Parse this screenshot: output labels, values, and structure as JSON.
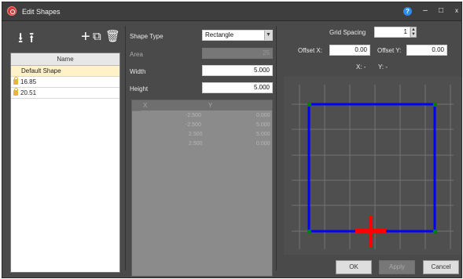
{
  "window": {
    "title": "Edit Shapes",
    "help_label": "?",
    "controls": [
      "–",
      "□",
      "x"
    ]
  },
  "toolbar": {
    "import_icon": "import-icon",
    "export_icon": "export-icon",
    "add_icon": "add-icon",
    "copy_icon": "copy-icon",
    "delete_icon": "delete-icon"
  },
  "shape_list": {
    "header": "Name",
    "items": [
      {
        "label": "Default Shape",
        "selected": true,
        "locked": false
      },
      {
        "label": "16.85",
        "selected": false,
        "locked": true
      },
      {
        "label": "20.51",
        "selected": false,
        "locked": true
      }
    ]
  },
  "properties": {
    "shape_type_label": "Shape Type",
    "shape_type_value": "Rectangle",
    "area_label": "Area",
    "area_value": "25",
    "width_label": "Width",
    "width_value": "5.000",
    "height_label": "Height",
    "height_value": "5.000"
  },
  "coordinates": {
    "x_header": "X",
    "y_header": "Y",
    "rows": [
      {
        "x": "-2.500",
        "y": "0.000"
      },
      {
        "x": "-2.500",
        "y": "5.000"
      },
      {
        "x": "2.500",
        "y": "5.000"
      },
      {
        "x": "2.500",
        "y": "0.000"
      }
    ]
  },
  "grid": {
    "spacing_label": "Grid Spacing",
    "spacing_value": "1",
    "offset_x_label": "Offset X:",
    "offset_x_value": "0.00",
    "offset_y_label": "Offset Y:",
    "offset_y_value": "0.00",
    "x_readout": "X: -",
    "y_readout": "Y: -"
  },
  "buttons": {
    "ok": "OK",
    "apply": "Apply",
    "cancel": "Cancel"
  },
  "colors": {
    "shape_outline": "#0000ff",
    "vertex": "#008000",
    "origin_marker": "#ff0000",
    "grid_line": "#737373"
  }
}
